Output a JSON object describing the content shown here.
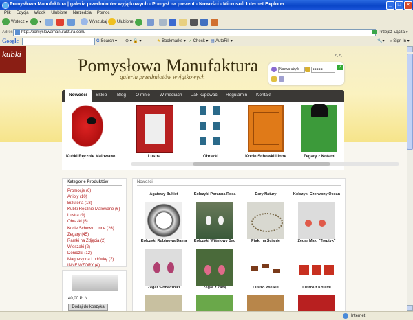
{
  "browser": {
    "window_title": "Pomysłowa Manufaktura | galeria przedmiotów wyjątkowych - Pomysł na prezent - Nowości - Microsoft Internet Explorer",
    "menu": [
      "Plik",
      "Edycja",
      "Widok",
      "Ulubione",
      "Narzędzia",
      "Pomoc"
    ],
    "toolbar": {
      "back": "Wstecz",
      "search": "Wyszukaj",
      "favorites": "Ulubione"
    },
    "address_label": "Adres",
    "address": "http://pomyslowamanufaktura.com/",
    "go": "Przejdź",
    "links": "Łącza",
    "google": {
      "logo": "Google",
      "search": "Search",
      "bookmarks": "Bookmarks",
      "check": "Check",
      "autofill": "AutoFill",
      "signin": "Sign In"
    },
    "status": {
      "left": "",
      "zone": "Internet"
    }
  },
  "site": {
    "logo_text": "kubki",
    "title": "Pomysłowa Manufaktura",
    "subtitle": "galeria przedmiotów wyjątkowych",
    "login": {
      "username_placeholder": "Nazwa użytk",
      "password_mask": "●●●●●",
      "go": "✓"
    },
    "font_size_control": "A A",
    "nav": [
      "Nowości",
      "Sklep",
      "Blog",
      "O mnie",
      "W mediach",
      "Jak kupować",
      "Regulamin",
      "Kontakt"
    ],
    "showcase": [
      "Kubki Ręcznie Malowane",
      "Lustra",
      "Obrazki",
      "Kocie Schowki i Inne",
      "Zegary z Kotami"
    ],
    "categories": {
      "heading": "Kategorie Produktów",
      "items": [
        "Promocje (6)",
        "Anioły (10)",
        "Biżuteria (18)",
        "Kubki Ręcznie Malowane (6)",
        "Lustra (9)",
        "Obrazki (6)",
        "Kocie Schowki i Inne (26)",
        "Zegary (45)",
        "Ramki na Zdjęcia (2)",
        "Wieszaki (2)",
        "Doniczki (12)",
        "Magnesy na Lodówkę (3)",
        "INNE WZORY (4)"
      ]
    },
    "cart": {
      "price": "40,00 PLN",
      "button": "Dodaj do koszyka"
    },
    "news": {
      "heading": "Nowości",
      "items": [
        "Agatowy Bukiet",
        "Kolczyki Poranna Rosa",
        "Dary Natury",
        "Kolczyki Czerwony Ocean",
        "Kolczyki Rubinowa Dama",
        "Kolczyki Wiśniowy Sad",
        "Ptaki na Ścianie",
        "Zegar Maki \"Tryptyk\"",
        "Zegar Słoneczniki",
        "Zegar z Żabą",
        "Lustro Wielkie",
        "Lustro z Kotami"
      ]
    }
  }
}
